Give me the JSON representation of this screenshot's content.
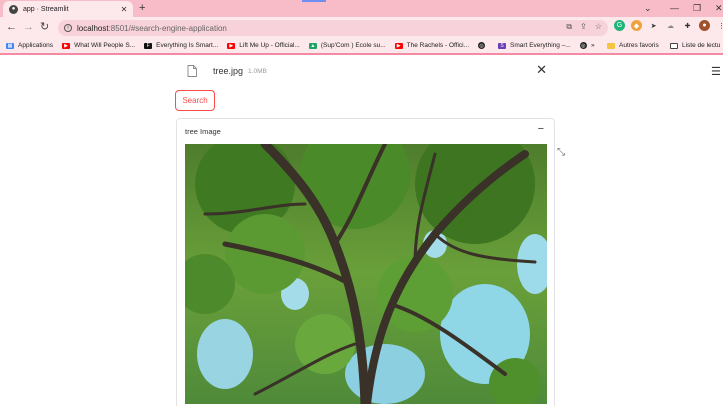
{
  "browser": {
    "tab_title": "app · Streamlit",
    "tab_favicon": "streamlit-icon",
    "new_tab_symbol": "+",
    "url_host": "localhost",
    "url_rest": ":8501/#search-engine-application",
    "window_controls": [
      "⌄",
      "—",
      "❐",
      "✕"
    ],
    "nav": {
      "back": "←",
      "forward": "→",
      "reload": "↻"
    }
  },
  "bookmarks": {
    "items": [
      {
        "label": "Applications",
        "icon": "apps-grid-icon",
        "color": "#4285f4"
      },
      {
        "label": "What Will People S...",
        "icon": "youtube-icon",
        "color": "#ff0000"
      },
      {
        "label": "Everything Is Smart...",
        "icon": "f-logo-icon",
        "color": "#111111"
      },
      {
        "label": "Lift Me Up - Official...",
        "icon": "youtube-icon",
        "color": "#ff0000"
      },
      {
        "label": "(Sup'Com ) Ecole su...",
        "icon": "drive-icon",
        "color": "#1fa463"
      },
      {
        "label": "The Rachels - Offici...",
        "icon": "youtube-icon",
        "color": "#ff0000"
      },
      {
        "label": "",
        "icon": "globe-icon",
        "color": "#222222"
      },
      {
        "label": "Smart Everything –...",
        "icon": "s-logo-icon",
        "color": "#6a3fb5"
      },
      {
        "label": "",
        "icon": "globe-icon",
        "color": "#222222"
      }
    ],
    "overflow": "»",
    "other_bookmarks": "Autres favoris",
    "reading_list": "Liste de lectu"
  },
  "uploader": {
    "file_name": "tree.jpg",
    "file_size": "1.0MB",
    "remove_symbol": "✕"
  },
  "search_button": {
    "label": "Search"
  },
  "expander": {
    "title": "tree Image",
    "toggle_symbol": "−"
  },
  "menu_symbol": "☰",
  "fullscreen_symbol": "⤡",
  "colors": {
    "accent": "#ff4b4b",
    "tab_bar": "#f8bcc8",
    "chrome": "#fde8ec"
  }
}
